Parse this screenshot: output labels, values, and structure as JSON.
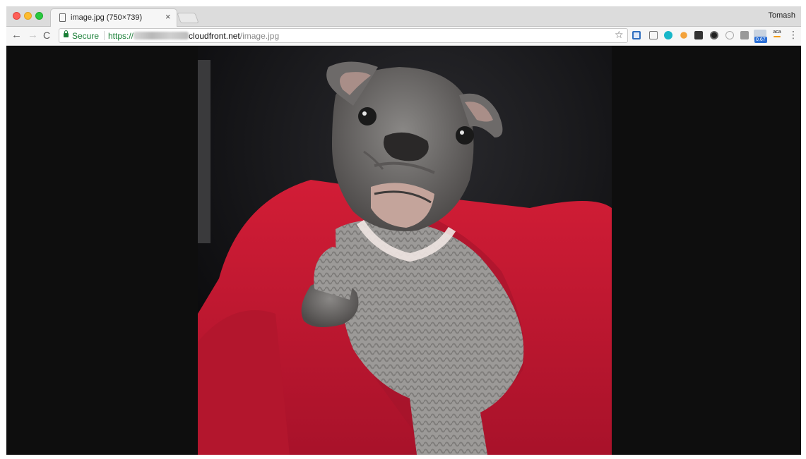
{
  "window": {
    "tab": {
      "title": "image.jpg (750×739)",
      "close_glyph": "×",
      "icon": "page-icon"
    },
    "profile_name": "Tomash"
  },
  "toolbar": {
    "back_glyph": "←",
    "forward_glyph": "→",
    "reload_glyph": "C",
    "security_label": "Secure",
    "url": {
      "scheme": "https://",
      "host": "cloudfront.net",
      "path": "/image.jpg"
    },
    "bookmark_glyph": "☆",
    "menu_glyph": "⋮",
    "extensions": [
      {
        "name": "extension-s-icon"
      },
      {
        "name": "extension-camera-icon"
      },
      {
        "name": "extension-teal-circle-icon"
      },
      {
        "name": "extension-orange-icon"
      },
      {
        "name": "extension-calendar-icon"
      },
      {
        "name": "extension-dark-circle-icon"
      },
      {
        "name": "extension-ring-icon"
      },
      {
        "name": "extension-gray-square-icon"
      },
      {
        "name": "extension-badge-icon",
        "badge": "0.67"
      },
      {
        "name": "extension-aca-icon",
        "label": "aca"
      }
    ]
  },
  "content": {
    "image_description": "photo of a gray French bulldog puppy in a knit sweater on a red cushion"
  },
  "colors": {
    "secure_green": "#1a7f37",
    "viewport_bg": "#0e0e0e",
    "badge_blue": "#2b6fd6"
  }
}
